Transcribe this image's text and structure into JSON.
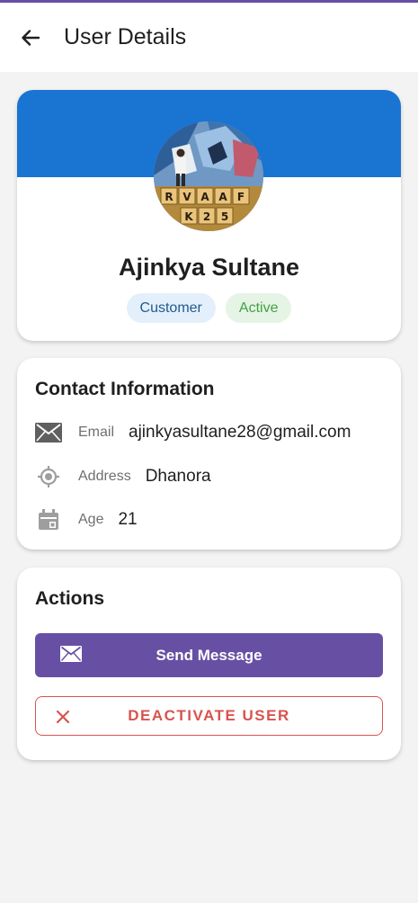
{
  "app_bar": {
    "title": "User Details",
    "back_icon": "arrow-left-icon"
  },
  "profile": {
    "name": "Ajinkya Sultane",
    "banner_color": "#1a74d2",
    "avatar_icon": "profile-photo",
    "role_badge": "Customer",
    "status_badge": "Active"
  },
  "contact": {
    "title": "Contact Information",
    "rows": [
      {
        "icon": "mail-icon",
        "label": "Email",
        "value": "ajinkyasultane28@gmail.com"
      },
      {
        "icon": "location-icon",
        "label": "Address",
        "value": "Dhanora"
      },
      {
        "icon": "calendar-icon",
        "label": "Age",
        "value": "21"
      }
    ]
  },
  "actions": {
    "title": "Actions",
    "send_message_label": "Send Message",
    "send_message_icon": "mail-icon",
    "deactivate_label": "DEACTIVATE USER",
    "deactivate_icon": "close-icon"
  },
  "colors": {
    "accent": "#6750a4",
    "primary_blue": "#1a74d2",
    "danger": "#d9534f",
    "success": "#43a047"
  }
}
